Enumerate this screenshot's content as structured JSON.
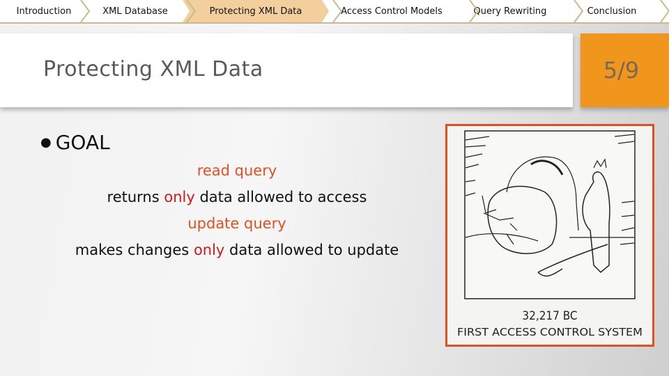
{
  "nav": {
    "items": [
      {
        "label": "Introduction",
        "active": false
      },
      {
        "label": "XML Database",
        "active": false
      },
      {
        "label": "Protecting XML Data",
        "active": true
      },
      {
        "label": "Access Control Models",
        "active": false
      },
      {
        "label": "Query Rewriting",
        "active": false
      },
      {
        "label": "Conclusion",
        "active": false
      }
    ]
  },
  "header": {
    "title": "Protecting XML Data",
    "page_indicator": "5/9"
  },
  "content": {
    "bullet": "GOAL",
    "lines": [
      {
        "parts": [
          {
            "text": "read query",
            "style": "orange"
          }
        ]
      },
      {
        "parts": [
          {
            "text": "returns ",
            "style": "plain"
          },
          {
            "text": "only",
            "style": "red"
          },
          {
            "text": " data allowed to access",
            "style": "plain"
          }
        ]
      },
      {
        "parts": [
          {
            "text": "update query",
            "style": "orange"
          }
        ]
      },
      {
        "parts": [
          {
            "text": "makes changes ",
            "style": "plain"
          },
          {
            "text": "only",
            "style": "red"
          },
          {
            "text": " data allowed to update",
            "style": "plain"
          }
        ]
      }
    ]
  },
  "image": {
    "description": "cartoon of caveman guarding boulder-blocked cave entrance",
    "caption_line1": "32,217 BC",
    "caption_line2": "FIRST ACCESS CONTROL SYSTEM"
  },
  "colors": {
    "accent_orange": "#f0961c",
    "highlight_orange": "#e2501f",
    "highlight_red": "#d11a1a",
    "nav_active": "#f4cf9e"
  }
}
